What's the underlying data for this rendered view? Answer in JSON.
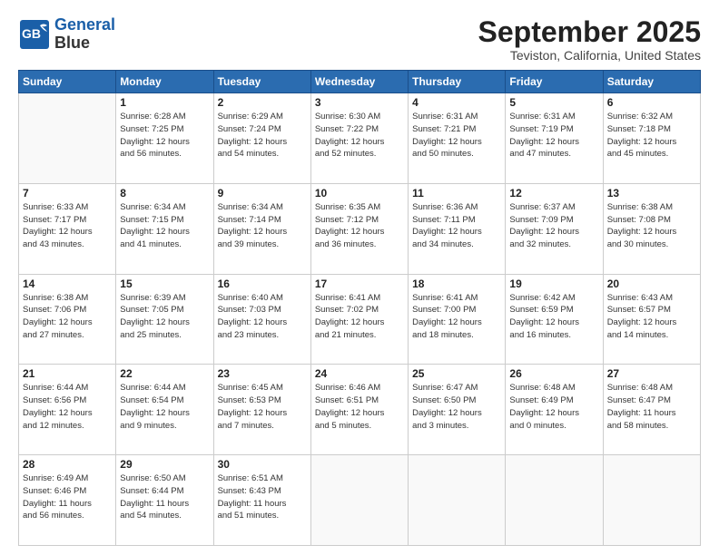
{
  "header": {
    "logo_line1": "General",
    "logo_line2": "Blue",
    "month": "September 2025",
    "location": "Teviston, California, United States"
  },
  "days_of_week": [
    "Sunday",
    "Monday",
    "Tuesday",
    "Wednesday",
    "Thursday",
    "Friday",
    "Saturday"
  ],
  "weeks": [
    [
      {
        "day": "",
        "info": ""
      },
      {
        "day": "1",
        "info": "Sunrise: 6:28 AM\nSunset: 7:25 PM\nDaylight: 12 hours\nand 56 minutes."
      },
      {
        "day": "2",
        "info": "Sunrise: 6:29 AM\nSunset: 7:24 PM\nDaylight: 12 hours\nand 54 minutes."
      },
      {
        "day": "3",
        "info": "Sunrise: 6:30 AM\nSunset: 7:22 PM\nDaylight: 12 hours\nand 52 minutes."
      },
      {
        "day": "4",
        "info": "Sunrise: 6:31 AM\nSunset: 7:21 PM\nDaylight: 12 hours\nand 50 minutes."
      },
      {
        "day": "5",
        "info": "Sunrise: 6:31 AM\nSunset: 7:19 PM\nDaylight: 12 hours\nand 47 minutes."
      },
      {
        "day": "6",
        "info": "Sunrise: 6:32 AM\nSunset: 7:18 PM\nDaylight: 12 hours\nand 45 minutes."
      }
    ],
    [
      {
        "day": "7",
        "info": "Sunrise: 6:33 AM\nSunset: 7:17 PM\nDaylight: 12 hours\nand 43 minutes."
      },
      {
        "day": "8",
        "info": "Sunrise: 6:34 AM\nSunset: 7:15 PM\nDaylight: 12 hours\nand 41 minutes."
      },
      {
        "day": "9",
        "info": "Sunrise: 6:34 AM\nSunset: 7:14 PM\nDaylight: 12 hours\nand 39 minutes."
      },
      {
        "day": "10",
        "info": "Sunrise: 6:35 AM\nSunset: 7:12 PM\nDaylight: 12 hours\nand 36 minutes."
      },
      {
        "day": "11",
        "info": "Sunrise: 6:36 AM\nSunset: 7:11 PM\nDaylight: 12 hours\nand 34 minutes."
      },
      {
        "day": "12",
        "info": "Sunrise: 6:37 AM\nSunset: 7:09 PM\nDaylight: 12 hours\nand 32 minutes."
      },
      {
        "day": "13",
        "info": "Sunrise: 6:38 AM\nSunset: 7:08 PM\nDaylight: 12 hours\nand 30 minutes."
      }
    ],
    [
      {
        "day": "14",
        "info": "Sunrise: 6:38 AM\nSunset: 7:06 PM\nDaylight: 12 hours\nand 27 minutes."
      },
      {
        "day": "15",
        "info": "Sunrise: 6:39 AM\nSunset: 7:05 PM\nDaylight: 12 hours\nand 25 minutes."
      },
      {
        "day": "16",
        "info": "Sunrise: 6:40 AM\nSunset: 7:03 PM\nDaylight: 12 hours\nand 23 minutes."
      },
      {
        "day": "17",
        "info": "Sunrise: 6:41 AM\nSunset: 7:02 PM\nDaylight: 12 hours\nand 21 minutes."
      },
      {
        "day": "18",
        "info": "Sunrise: 6:41 AM\nSunset: 7:00 PM\nDaylight: 12 hours\nand 18 minutes."
      },
      {
        "day": "19",
        "info": "Sunrise: 6:42 AM\nSunset: 6:59 PM\nDaylight: 12 hours\nand 16 minutes."
      },
      {
        "day": "20",
        "info": "Sunrise: 6:43 AM\nSunset: 6:57 PM\nDaylight: 12 hours\nand 14 minutes."
      }
    ],
    [
      {
        "day": "21",
        "info": "Sunrise: 6:44 AM\nSunset: 6:56 PM\nDaylight: 12 hours\nand 12 minutes."
      },
      {
        "day": "22",
        "info": "Sunrise: 6:44 AM\nSunset: 6:54 PM\nDaylight: 12 hours\nand 9 minutes."
      },
      {
        "day": "23",
        "info": "Sunrise: 6:45 AM\nSunset: 6:53 PM\nDaylight: 12 hours\nand 7 minutes."
      },
      {
        "day": "24",
        "info": "Sunrise: 6:46 AM\nSunset: 6:51 PM\nDaylight: 12 hours\nand 5 minutes."
      },
      {
        "day": "25",
        "info": "Sunrise: 6:47 AM\nSunset: 6:50 PM\nDaylight: 12 hours\nand 3 minutes."
      },
      {
        "day": "26",
        "info": "Sunrise: 6:48 AM\nSunset: 6:49 PM\nDaylight: 12 hours\nand 0 minutes."
      },
      {
        "day": "27",
        "info": "Sunrise: 6:48 AM\nSunset: 6:47 PM\nDaylight: 11 hours\nand 58 minutes."
      }
    ],
    [
      {
        "day": "28",
        "info": "Sunrise: 6:49 AM\nSunset: 6:46 PM\nDaylight: 11 hours\nand 56 minutes."
      },
      {
        "day": "29",
        "info": "Sunrise: 6:50 AM\nSunset: 6:44 PM\nDaylight: 11 hours\nand 54 minutes."
      },
      {
        "day": "30",
        "info": "Sunrise: 6:51 AM\nSunset: 6:43 PM\nDaylight: 11 hours\nand 51 minutes."
      },
      {
        "day": "",
        "info": ""
      },
      {
        "day": "",
        "info": ""
      },
      {
        "day": "",
        "info": ""
      },
      {
        "day": "",
        "info": ""
      }
    ]
  ]
}
